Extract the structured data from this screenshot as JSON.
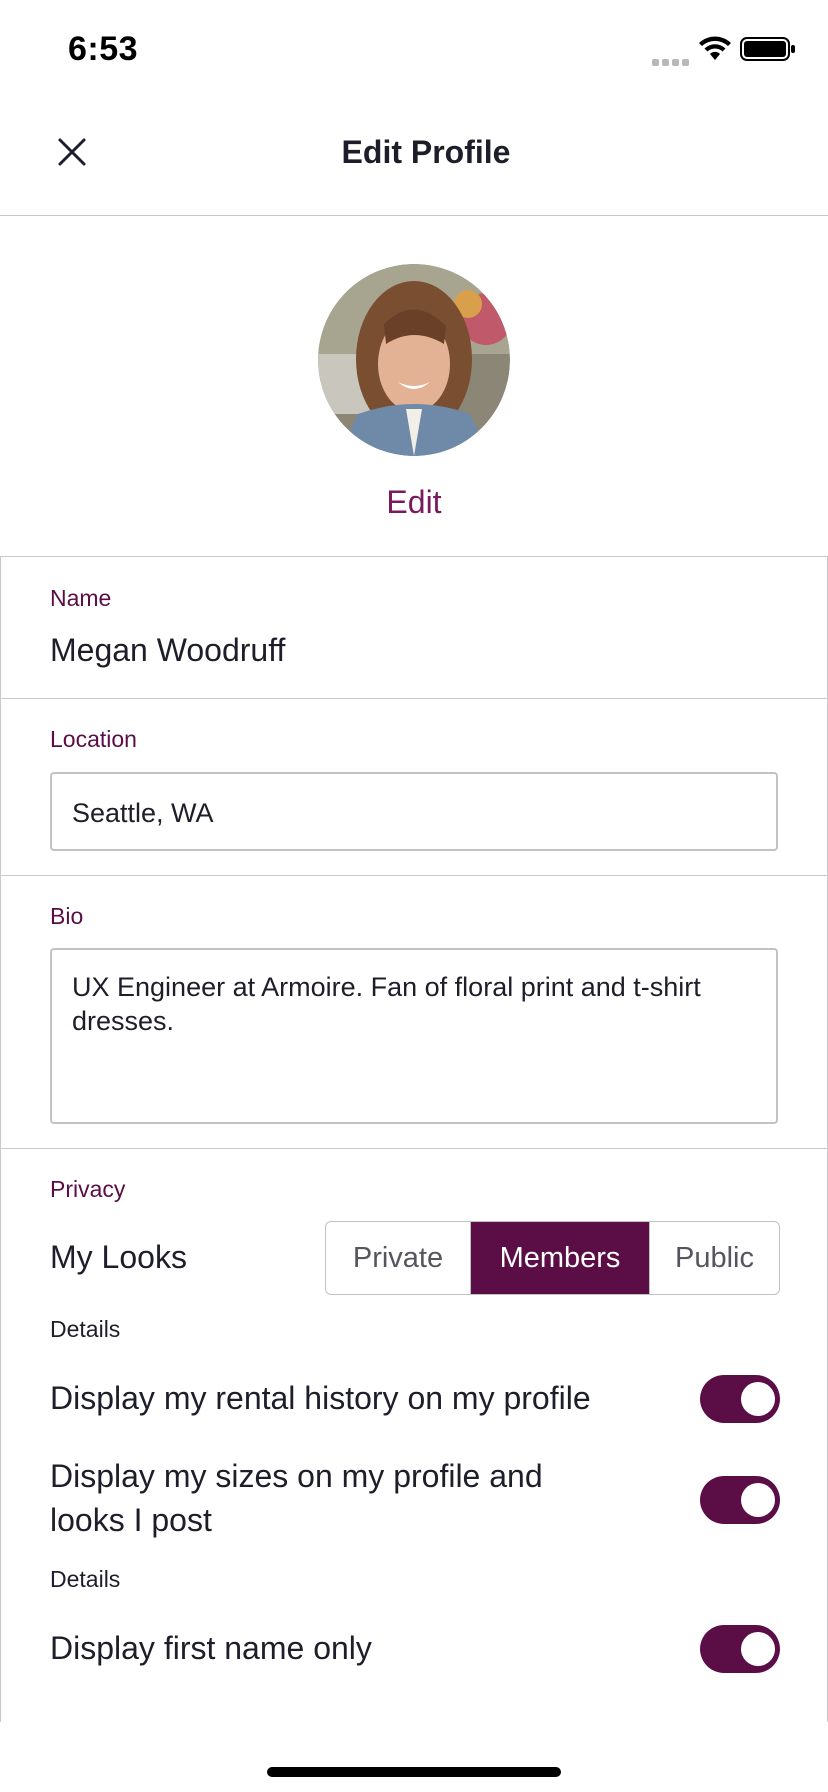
{
  "status_bar": {
    "time": "6:53"
  },
  "header": {
    "title": "Edit Profile",
    "close_icon": "close-icon"
  },
  "avatar": {
    "edit_label": "Edit"
  },
  "fields": {
    "name": {
      "label": "Name",
      "value": "Megan Woodruff"
    },
    "location": {
      "label": "Location",
      "value": "Seattle, WA"
    },
    "bio": {
      "label": "Bio",
      "value": "UX Engineer at Armoire. Fan of floral print and t-shirt dresses."
    }
  },
  "privacy": {
    "label": "Privacy",
    "my_looks_label": "My Looks",
    "options": [
      "Private",
      "Members",
      "Public"
    ],
    "selected": "Members",
    "details_label": "Details",
    "toggles": [
      {
        "label": "Display my rental history on my profile",
        "on": true
      },
      {
        "label": "Display my sizes on my profile and looks I post",
        "on": true
      },
      {
        "label": "Display first name only",
        "on": true
      }
    ],
    "details_label_2": "Details"
  },
  "colors": {
    "accent": "#5b0e46",
    "edit_link": "#7a1a5c",
    "divider": "#c9c9cd"
  }
}
